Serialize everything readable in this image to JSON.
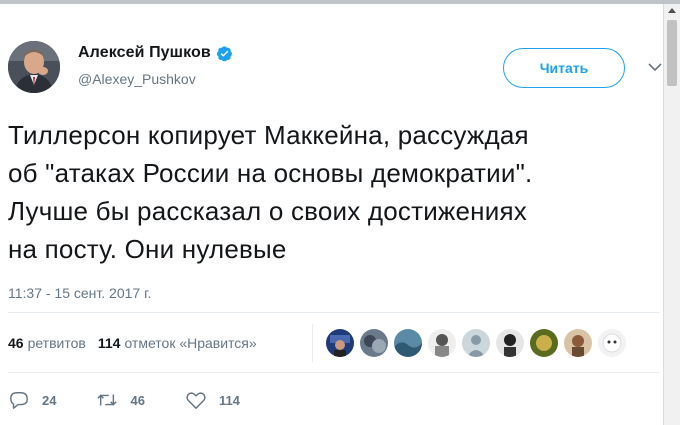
{
  "tweet": {
    "author_name": "Алексей Пушков",
    "handle": "@Alexey_Pushkov",
    "follow_label": "Читать",
    "text_lines": [
      "Тиллерсон копирует Маккейна, рассуждая",
      "об \"атаках России на основы демократии\".",
      "Лучше бы рассказал о своих достижениях",
      "на посту. Они нулевые"
    ],
    "timestamp": "11:37 - 15 сент. 2017 г.",
    "retweet_count": "46",
    "retweet_label": "ретвитов",
    "like_count": "114",
    "like_label": "отметок «Нравится»",
    "actions": {
      "reply_count": "24",
      "retweet_count": "46",
      "like_count": "114"
    }
  },
  "colors": {
    "accent": "#1da1f2",
    "text": "#14171a",
    "muted": "#657786",
    "divider": "#e6ecf0"
  },
  "icons": [
    "verified-icon",
    "chevron-down-icon",
    "reply-icon",
    "retweet-icon",
    "like-icon"
  ],
  "likers_count": 9
}
